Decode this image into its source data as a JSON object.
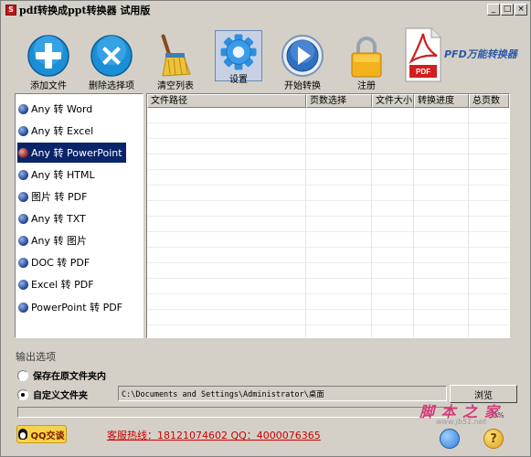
{
  "window": {
    "title": "pdf转换成ppt转换器 试用版",
    "icon_text": "S",
    "controls": {
      "minimize": "_",
      "maximize": "□",
      "close": "×"
    }
  },
  "toolbar": {
    "add_files": "添加文件",
    "remove_selected": "删除选择项",
    "clear_list": "清空列表",
    "settings": "设置",
    "start_convert": "开始转换",
    "register": "注册",
    "brand_name": "PFD万能转换器",
    "brand_badge": "PDF"
  },
  "conversion_types": {
    "items": [
      {
        "label": "Any 转 Word",
        "selected": false
      },
      {
        "label": "Any 转 Excel",
        "selected": false
      },
      {
        "label": "Any 转 PowerPoint",
        "selected": true
      },
      {
        "label": "Any 转 HTML",
        "selected": false
      },
      {
        "label": "图片 转 PDF",
        "selected": false
      },
      {
        "label": "Any 转 TXT",
        "selected": false
      },
      {
        "label": "Any 转 图片",
        "selected": false
      },
      {
        "label": "DOC 转 PDF",
        "selected": false
      },
      {
        "label": "Excel 转 PDF",
        "selected": false
      },
      {
        "label": "PowerPoint 转 PDF",
        "selected": false
      }
    ]
  },
  "file_table": {
    "columns": [
      "文件路径",
      "页数选择",
      "文件大小",
      "转换进度",
      "总页数"
    ],
    "rows": []
  },
  "output": {
    "section_title": "输出选项",
    "option_original": "保存在原文件夹内",
    "option_custom": "自定义文件夹",
    "selected_option": "custom",
    "path_value": "C:\\Documents and Settings\\Administrator\\桌面",
    "browse_label": "浏览",
    "progress_percent": 0,
    "progress_text": "0%"
  },
  "footer": {
    "qq_label": "QQ交谈",
    "hotline": "客服热线：18121074602 QQ：4000076365",
    "watermark_main": "脚 本 之 家",
    "watermark_url": "www.jb51.net",
    "help_icon": "?"
  },
  "colors": {
    "window_bg": "#d4d0c8",
    "selection": "#0a246a",
    "hotline": "#cc0000",
    "brand": "#2b58a8"
  }
}
